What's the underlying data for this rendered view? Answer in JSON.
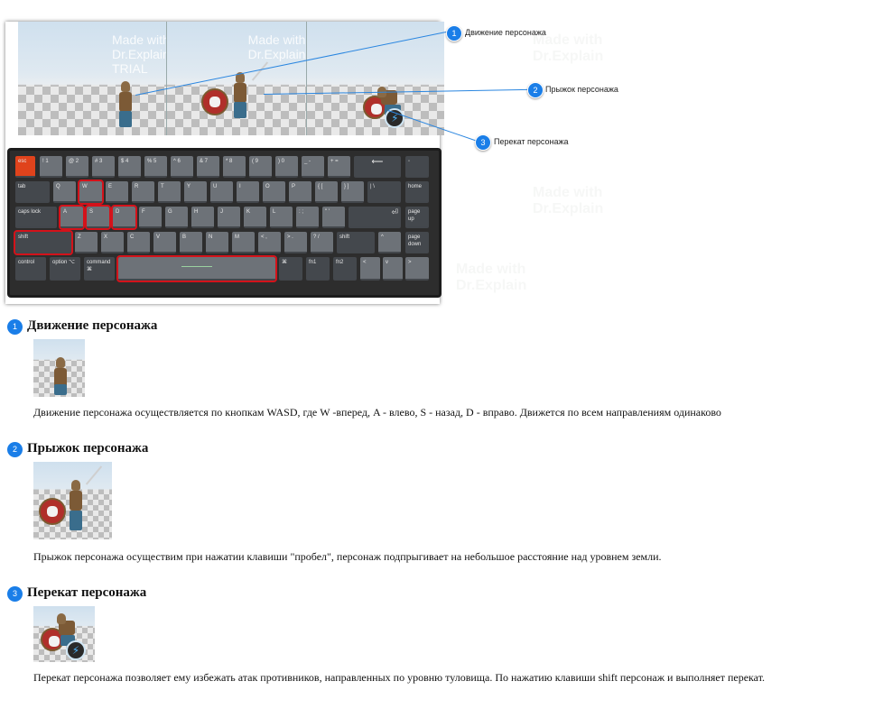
{
  "watermark": {
    "line1": "Made with",
    "line2": "Dr.Explain",
    "line3": "TRIAL"
  },
  "callouts": [
    {
      "number": "1",
      "label": "Движение персонажа"
    },
    {
      "number": "2",
      "label": "Прыжок персонажа"
    },
    {
      "number": "3",
      "label": "Перекат персонажа"
    }
  ],
  "keyboard": {
    "row1": [
      "esc",
      "! 1",
      "@ 2",
      "# 3",
      "$ 4",
      "% 5",
      "^ 6",
      "& 7",
      "* 8",
      "( 9",
      ") 0",
      "_ -",
      "+ =",
      "⟵",
      "◦"
    ],
    "row2": [
      "tab",
      "Q",
      "W",
      "E",
      "R",
      "T",
      "Y",
      "U",
      "I",
      "O",
      "P",
      "{ [",
      "} ]",
      "| \\",
      "home"
    ],
    "row3": [
      "caps lock",
      "A",
      "S",
      "D",
      "F",
      "G",
      "H",
      "J",
      "K",
      "L",
      ": ;",
      "\" '",
      "⏎",
      "page up"
    ],
    "row4": [
      "shift",
      "Z",
      "X",
      "C",
      "V",
      "B",
      "N",
      "M",
      "< ,",
      "> .",
      "? /",
      "shift",
      "^",
      "page down"
    ],
    "row5": [
      "control",
      "option ⌥",
      "command ⌘",
      "",
      "⌘",
      "fn1",
      "fn2",
      "<",
      "v",
      ">"
    ]
  },
  "sections": [
    {
      "number": "1",
      "title": "Движение персонажа",
      "text": "Движение персонажа осуществляется по кнопкам WASD, где W -вперед, A - влево, S - назад, D - вправо. Движется по всем направлениям одинаково"
    },
    {
      "number": "2",
      "title": "Прыжок персонажа",
      "text": "Прыжок персонажа осуществим при нажатии клавиши \"пробел\", персонаж подпрыгивает на небольшое расстояние над уровнем земли."
    },
    {
      "number": "3",
      "title": "Перекат персонажа",
      "text": "Перекат персонажа позволяет ему избежать атак противников, направленных по уровню туловища. По нажатию клавиши shift персонаж и выполняет перекат."
    }
  ],
  "colors": {
    "badge": "#1a7ee8",
    "highlight": "#d4121a",
    "esc_key": "#e0431c"
  }
}
